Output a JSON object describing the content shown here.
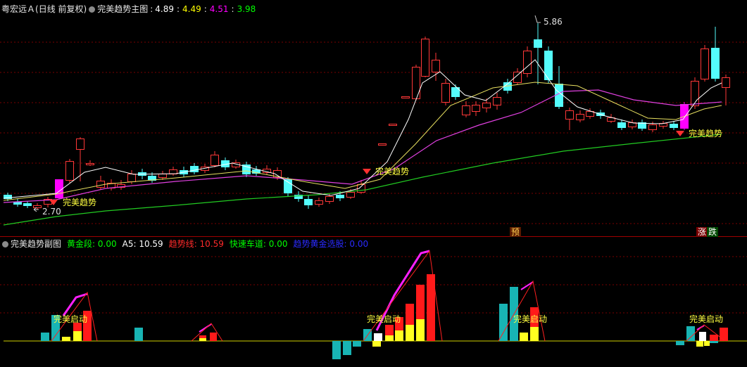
{
  "main_header": {
    "stock": "粤宏远Ａ",
    "period": "(日线 前复权)",
    "indicator": "完美趋势主图",
    "v1": "4.89",
    "v2": "4.49",
    "v3": "4.51",
    "v4": "3.98",
    "colors": {
      "v1": "#ffffff",
      "v2": "#ffff00",
      "v3": "#ff00ff",
      "v4": "#00ff00"
    }
  },
  "sub_header": {
    "indicator": "完美趋势副图",
    "items": [
      {
        "label": "黄金段",
        "value": "0.00",
        "color": "#00ff00"
      },
      {
        "label": "A5",
        "value": "10.59",
        "color": "#ffffff"
      },
      {
        "label": "趋势线",
        "value": "10.59",
        "color": "#ff2a2a"
      },
      {
        "label": "快速车道",
        "value": "0.00",
        "color": "#00ff00"
      },
      {
        "label": "趋势黄金选股",
        "value": "0.00",
        "color": "#1a1aff"
      }
    ]
  },
  "annotations": {
    "high_price": "5.86",
    "low_price": "2.70",
    "main_signal": "完美趋势",
    "sub_signal": "完美启动",
    "badge_yu": "预",
    "badge_zhang": "涨",
    "badge_die": "跌"
  }
}
